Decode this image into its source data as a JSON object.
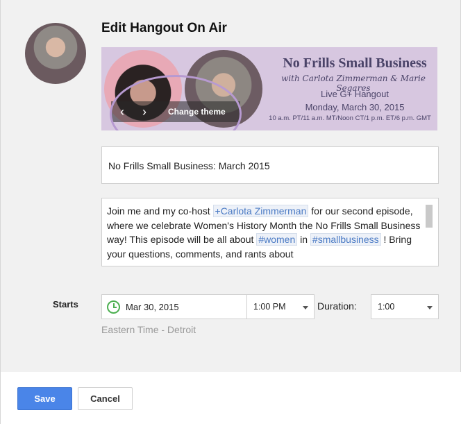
{
  "dialog": {
    "title": "Edit Hangout On Air"
  },
  "banner": {
    "show_title": "No Frills Small Business",
    "subtitle": "with Carlota Zimmerman & Marie Segares",
    "event_type": "Live G+ Hangout",
    "date": "Monday, March 30, 2015",
    "times": "10 a.m. PT/11 a.m. MT/Noon CT/1 p.m. ET/6 p.m. GMT",
    "change_theme_label": "Change theme",
    "prev_icon": "chevron-left-icon",
    "next_icon": "chevron-right-icon"
  },
  "form": {
    "name_value": "No Frills Small Business: March 2015",
    "description": {
      "t1": "Join me and my co-host ",
      "mention": "+Carlota Zimmerman",
      "t2": " for our second episode, where we celebrate Women's History Month the No Frills Small Business way! This episode will be all about ",
      "tag1": "#women",
      "t3": " in ",
      "tag2": "#smallbusiness",
      "t4": " ! Bring your questions, comments, and rants about"
    },
    "starts_label": "Starts",
    "date_value": "Mar 30, 2015",
    "time_value": "1:00 PM",
    "duration_label": "Duration:",
    "duration_value": "1:00",
    "timezone": "Eastern Time - Detroit"
  },
  "footer": {
    "save_label": "Save",
    "cancel_label": "Cancel"
  },
  "colors": {
    "accent": "#4a85e8",
    "mention": "#4a7ac4",
    "clock": "#4caf50"
  }
}
